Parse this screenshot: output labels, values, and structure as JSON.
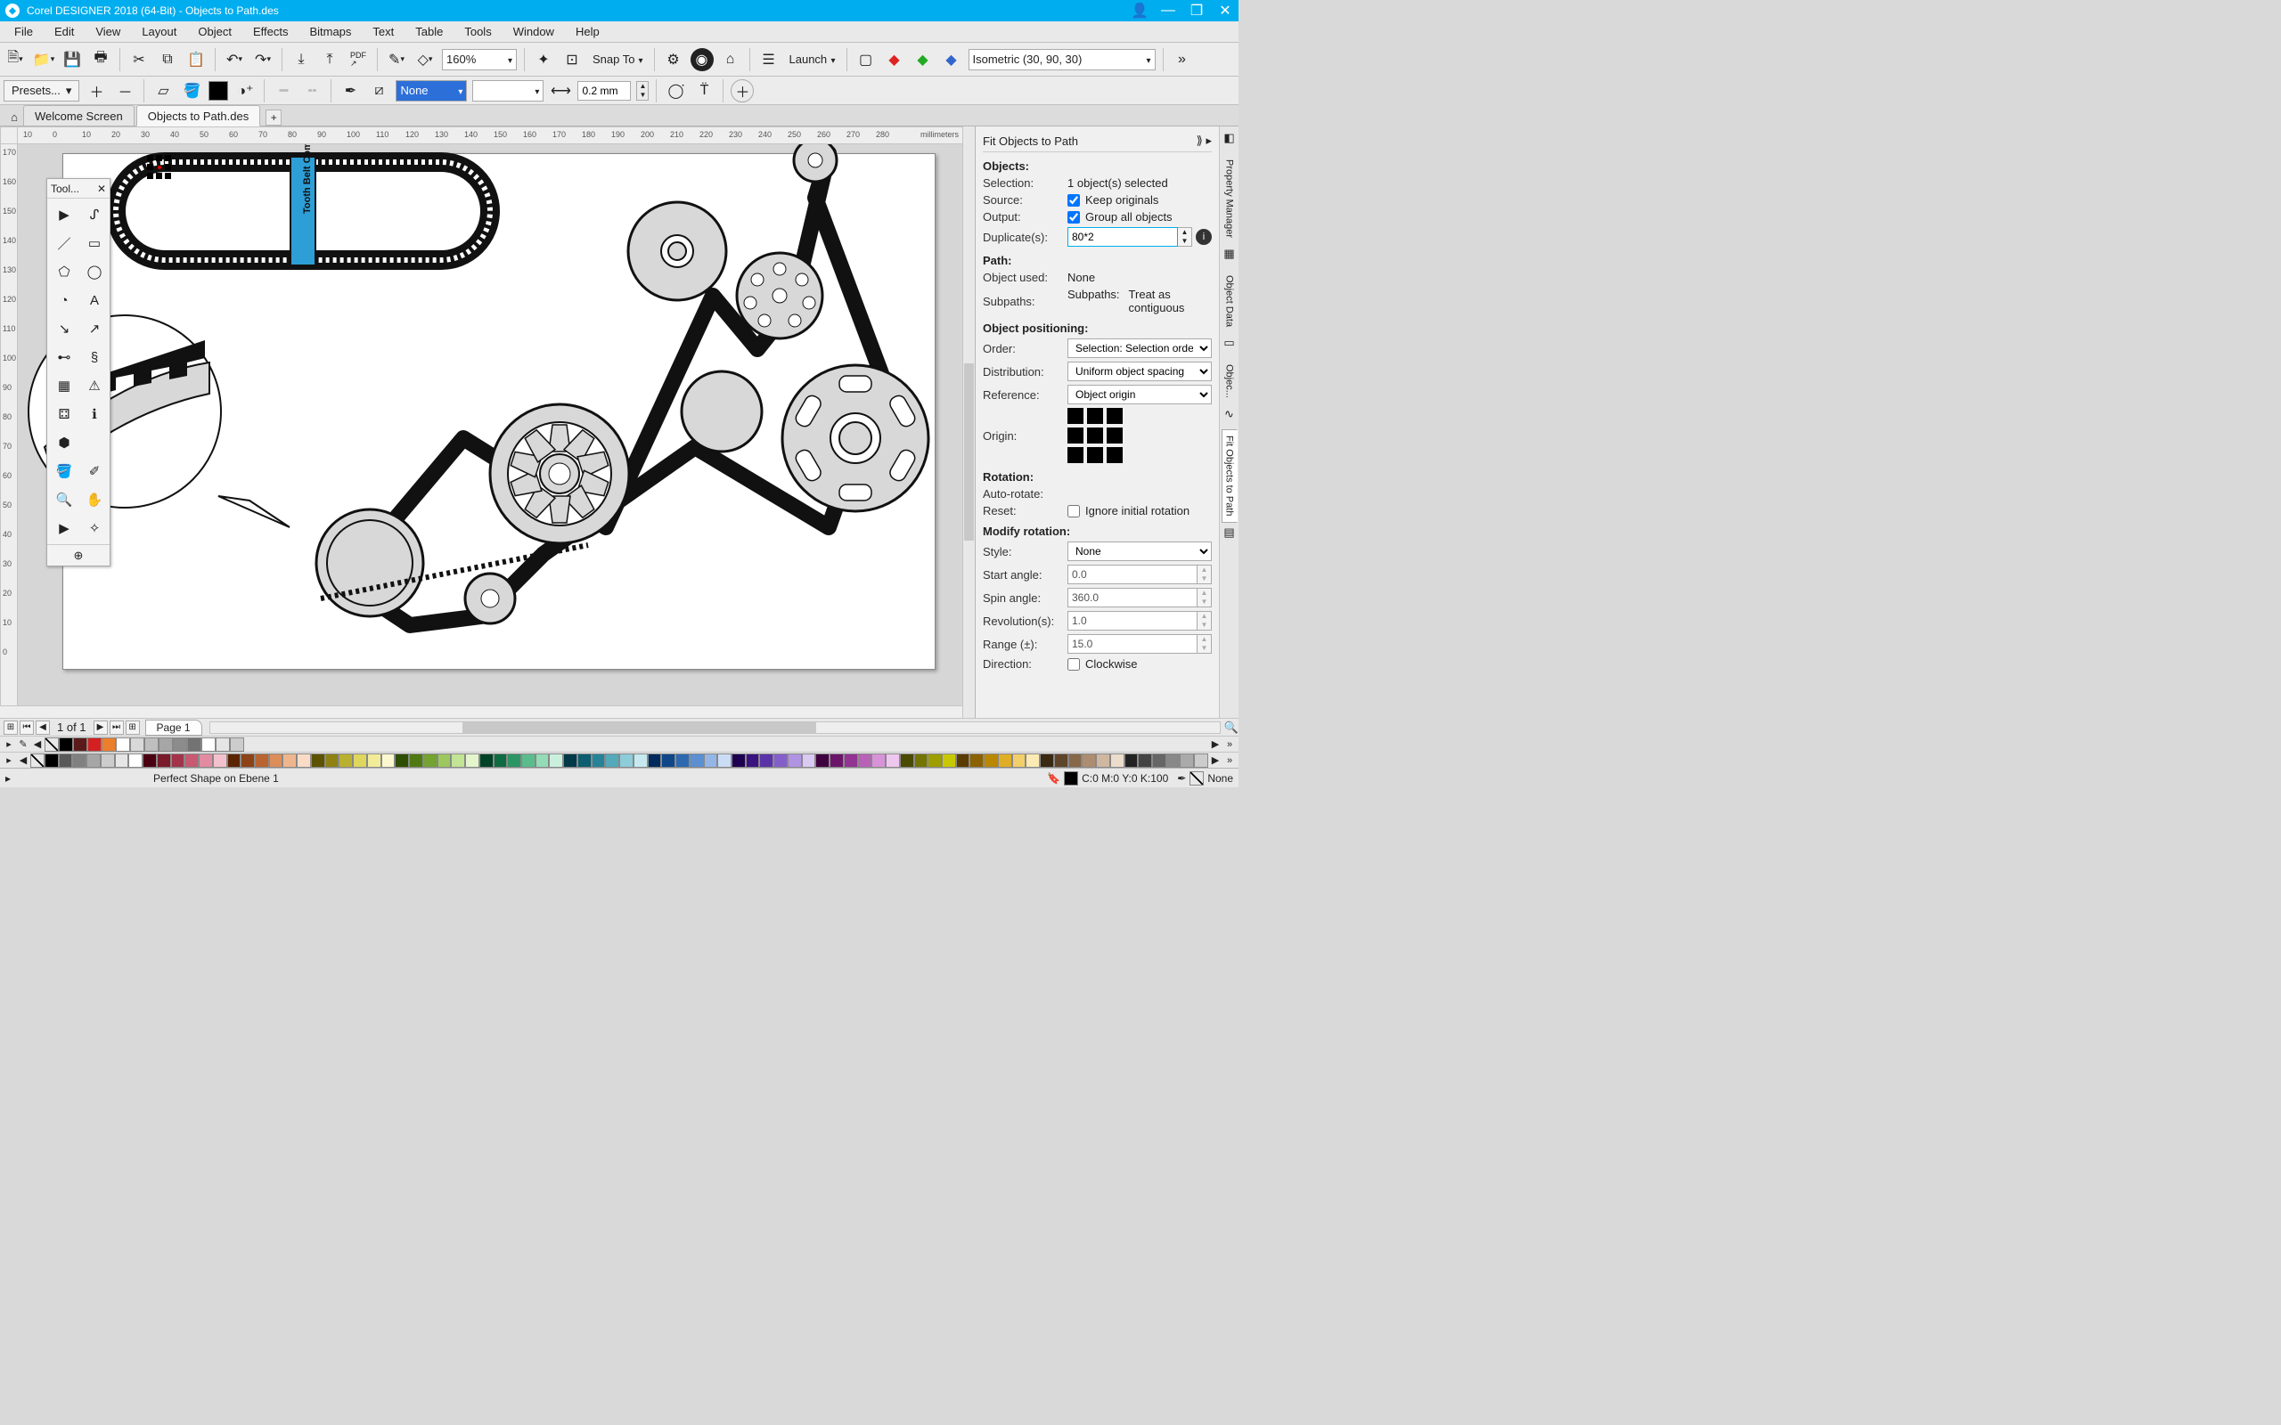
{
  "titlebar": {
    "title": "Corel DESIGNER 2018 (64-Bit) - Objects to Path.des"
  },
  "menu": [
    "File",
    "Edit",
    "View",
    "Layout",
    "Object",
    "Effects",
    "Bitmaps",
    "Text",
    "Table",
    "Tools",
    "Window",
    "Help"
  ],
  "toolbar1": {
    "zoom": "160%",
    "snap_label": "Snap To",
    "launch_label": "Launch",
    "proj_preset": "Isometric (30, 90, 30)"
  },
  "toolbar2": {
    "presets_label": "Presets...",
    "outline_color_label": "None",
    "outline_width": "",
    "corner_val": "0.2 mm"
  },
  "tabs": {
    "welcome": "Welcome Screen",
    "doc": "Objects to Path.des"
  },
  "toolbox": {
    "title": "Tool..."
  },
  "ruler_unit": "millimeters",
  "ruler_h": [
    "10",
    "0",
    "10",
    "20",
    "30",
    "40",
    "50",
    "60",
    "70",
    "80",
    "90",
    "100",
    "110",
    "120",
    "130",
    "140",
    "150",
    "160",
    "170",
    "180",
    "190",
    "200",
    "210",
    "220",
    "230",
    "240",
    "250",
    "260",
    "270",
    "280"
  ],
  "ruler_v": [
    "170",
    "160",
    "150",
    "140",
    "130",
    "120",
    "110",
    "100",
    "90",
    "80",
    "70",
    "60",
    "50",
    "40",
    "30",
    "20",
    "10",
    "0"
  ],
  "canvas": {
    "belt_label": "Tooth Belt Compamny"
  },
  "page_nav": {
    "counter": "1  of  1",
    "page_tab": "Page 1"
  },
  "docker": {
    "title": "Fit Objects to Path",
    "objects_h": "Objects:",
    "selection_lbl": "Selection:",
    "selection_val": "1 object(s) selected",
    "source_lbl": "Source:",
    "keep_originals": "Keep originals",
    "output_lbl": "Output:",
    "group_all": "Group all objects",
    "duplicates_lbl": "Duplicate(s):",
    "duplicates_val": "80*2",
    "path_h": "Path:",
    "object_used_lbl": "Object used:",
    "object_used_val": "None",
    "subpaths_lbl": "Subpaths:",
    "subpaths_val_a": "Subpaths:",
    "subpaths_val_b": "Treat as contiguous",
    "obj_pos_h": "Object positioning:",
    "order_lbl": "Order:",
    "order_val": "Selection: Selection order",
    "dist_lbl": "Distribution:",
    "dist_val": "Uniform object spacing",
    "ref_lbl": "Reference:",
    "ref_val": "Object origin",
    "origin_lbl": "Origin:",
    "rotation_h": "Rotation:",
    "autorotate_lbl": "Auto-rotate:",
    "reset_lbl": "Reset:",
    "ignore_initial": "Ignore initial rotation",
    "modrot_h": "Modify rotation:",
    "style_lbl": "Style:",
    "style_val": "None",
    "start_angle_lbl": "Start angle:",
    "start_angle_val": "0.0",
    "spin_angle_lbl": "Spin angle:",
    "spin_angle_val": "360.0",
    "rev_lbl": "Revolution(s):",
    "rev_val": "1.0",
    "range_lbl": "Range (±):",
    "range_val": "15.0",
    "direction_lbl": "Direction:",
    "clockwise": "Clockwise",
    "side_tabs": [
      "Property Manager",
      "Object Data",
      "Objec...",
      "Fit Objects to Path"
    ]
  },
  "status": {
    "context": "Perfect Shape on Ebene 1",
    "cmyk": "C:0 M:0 Y:0 K:100",
    "none_label": "None"
  },
  "palette1": [
    "#000000",
    "#5a1a1a",
    "#d42020",
    "#ec7f2b",
    "#ffffff",
    "#d9d9d9",
    "#bfbfbf",
    "#a6a6a6",
    "#8c8c8c",
    "#737373",
    "#ffffff",
    "#e5e5e5",
    "#cccccc"
  ],
  "palette2": [
    "#000",
    "#595959",
    "#808080",
    "#a6a6a6",
    "#cccccc",
    "#e6e6e6",
    "#fff",
    "#4b0011",
    "#7a1b2b",
    "#a33349",
    "#c75a72",
    "#e38ba0",
    "#f5c0cd",
    "#5a2400",
    "#8c4317",
    "#b96431",
    "#db8d5a",
    "#efb68e",
    "#fadcc6",
    "#5c5200",
    "#8e8112",
    "#bab02f",
    "#dfd65e",
    "#f2ec9a",
    "#fbf8d0",
    "#2f4f00",
    "#4f7a12",
    "#73a331",
    "#9cc85e",
    "#c3e494",
    "#e4f4cb",
    "#004225",
    "#0f6b41",
    "#2b9663",
    "#5abc8d",
    "#93dcb7",
    "#caf0dd",
    "#003947",
    "#0c5d6f",
    "#268397",
    "#54a9bb",
    "#8dccd9",
    "#c6e9f0",
    "#002a5c",
    "#0f4788",
    "#2e69b0",
    "#5b8fd1",
    "#93b6e6",
    "#cbdcf5",
    "#1e0050",
    "#3a1380",
    "#5a33a8",
    "#845fca",
    "#b093e2",
    "#dac9f3",
    "#3f003f",
    "#6a156a",
    "#933393",
    "#b960b9",
    "#d893d8",
    "#efc6ef",
    "#4a4a00",
    "#747400",
    "#9e9e00",
    "#c8c800",
    "#5a3b00",
    "#8c6100",
    "#b98800",
    "#e0ae26",
    "#f2cf6b",
    "#fbeab5",
    "#3a2a12",
    "#5f462a",
    "#876849",
    "#ad8d70",
    "#d0b7a0",
    "#ecdccb",
    "#222",
    "#444",
    "#666",
    "#888",
    "#aaa",
    "#ccc"
  ]
}
